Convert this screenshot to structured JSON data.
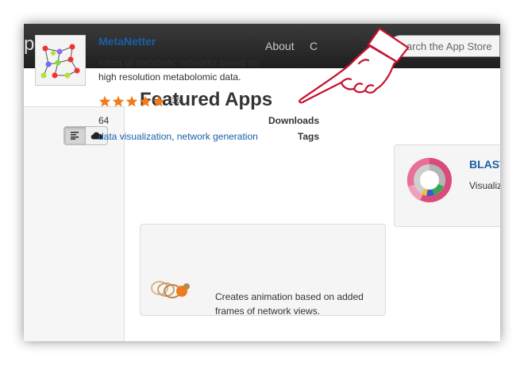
{
  "brand": "p store",
  "nav": {
    "about": "About",
    "contact": "C"
  },
  "search": {
    "placeholder": "Search the App Store"
  },
  "main": {
    "section_title": "Featured Apps"
  },
  "featured_app": {
    "name": "MetaNetter",
    "description": [
      "Infers of metabolic networks based on",
      "high resolution metabolomic data."
    ],
    "rating": 5,
    "rating_count": "(36)",
    "downloads_label": "Downloads",
    "downloads": "64",
    "tags_label": "Tags",
    "tags": [
      "data visualization",
      "network generation"
    ],
    "tag_separator": ","
  },
  "second_app": {
    "description": [
      "Creates animation based on added",
      "frames of network views."
    ]
  },
  "blast_app": {
    "name": "BLAST",
    "description": "Visualiz"
  },
  "colors": {
    "link": "#1a5fa8",
    "star": "#f07b1d",
    "hand_outline": "#c8102e"
  },
  "icons": [
    "list-icon",
    "cloud-icon",
    "star-icon",
    "pointing-hand-icon"
  ]
}
